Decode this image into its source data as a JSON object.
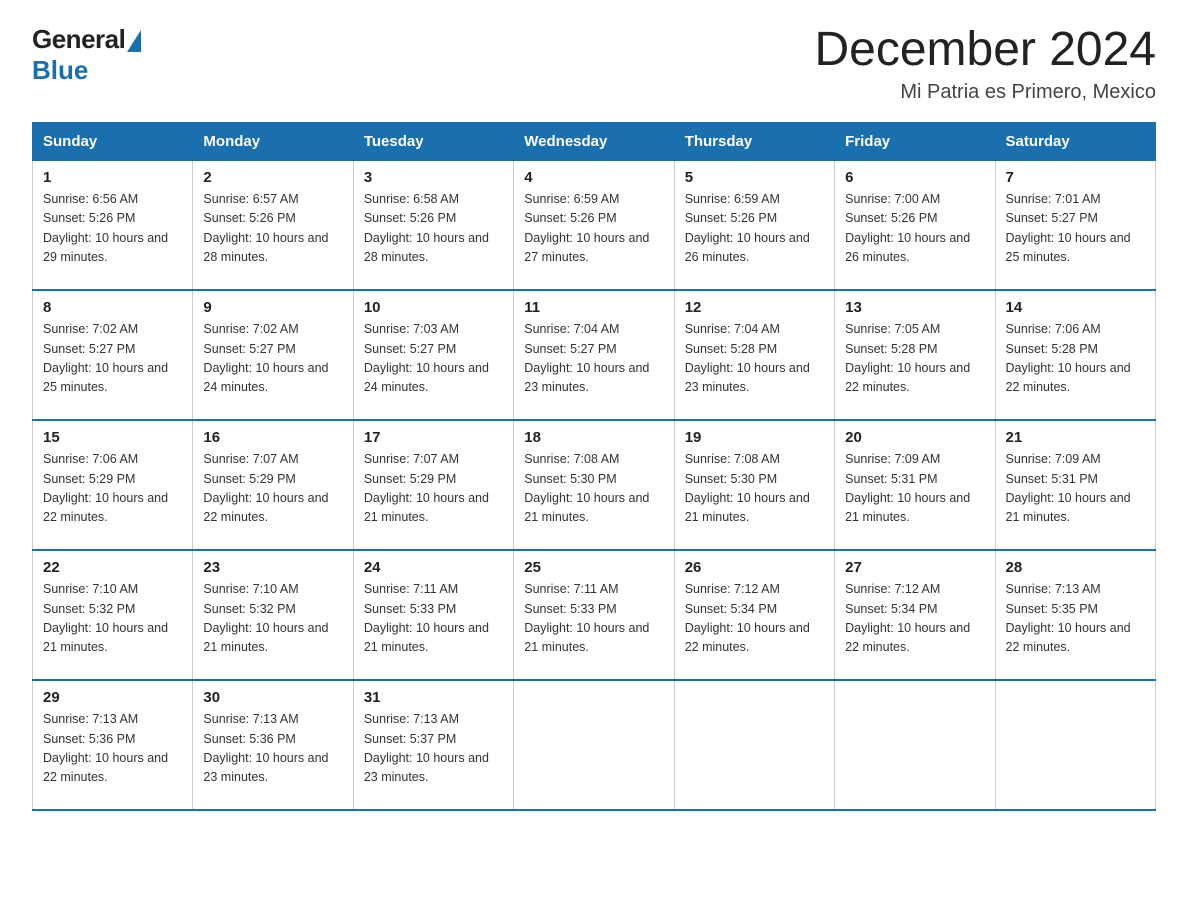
{
  "header": {
    "logo_general": "General",
    "logo_blue": "Blue",
    "title": "December 2024",
    "subtitle": "Mi Patria es Primero, Mexico"
  },
  "weekdays": [
    "Sunday",
    "Monday",
    "Tuesday",
    "Wednesday",
    "Thursday",
    "Friday",
    "Saturday"
  ],
  "weeks": [
    [
      {
        "day": "1",
        "sunrise": "6:56 AM",
        "sunset": "5:26 PM",
        "daylight": "10 hours and 29 minutes."
      },
      {
        "day": "2",
        "sunrise": "6:57 AM",
        "sunset": "5:26 PM",
        "daylight": "10 hours and 28 minutes."
      },
      {
        "day": "3",
        "sunrise": "6:58 AM",
        "sunset": "5:26 PM",
        "daylight": "10 hours and 28 minutes."
      },
      {
        "day": "4",
        "sunrise": "6:59 AM",
        "sunset": "5:26 PM",
        "daylight": "10 hours and 27 minutes."
      },
      {
        "day": "5",
        "sunrise": "6:59 AM",
        "sunset": "5:26 PM",
        "daylight": "10 hours and 26 minutes."
      },
      {
        "day": "6",
        "sunrise": "7:00 AM",
        "sunset": "5:26 PM",
        "daylight": "10 hours and 26 minutes."
      },
      {
        "day": "7",
        "sunrise": "7:01 AM",
        "sunset": "5:27 PM",
        "daylight": "10 hours and 25 minutes."
      }
    ],
    [
      {
        "day": "8",
        "sunrise": "7:02 AM",
        "sunset": "5:27 PM",
        "daylight": "10 hours and 25 minutes."
      },
      {
        "day": "9",
        "sunrise": "7:02 AM",
        "sunset": "5:27 PM",
        "daylight": "10 hours and 24 minutes."
      },
      {
        "day": "10",
        "sunrise": "7:03 AM",
        "sunset": "5:27 PM",
        "daylight": "10 hours and 24 minutes."
      },
      {
        "day": "11",
        "sunrise": "7:04 AM",
        "sunset": "5:27 PM",
        "daylight": "10 hours and 23 minutes."
      },
      {
        "day": "12",
        "sunrise": "7:04 AM",
        "sunset": "5:28 PM",
        "daylight": "10 hours and 23 minutes."
      },
      {
        "day": "13",
        "sunrise": "7:05 AM",
        "sunset": "5:28 PM",
        "daylight": "10 hours and 22 minutes."
      },
      {
        "day": "14",
        "sunrise": "7:06 AM",
        "sunset": "5:28 PM",
        "daylight": "10 hours and 22 minutes."
      }
    ],
    [
      {
        "day": "15",
        "sunrise": "7:06 AM",
        "sunset": "5:29 PM",
        "daylight": "10 hours and 22 minutes."
      },
      {
        "day": "16",
        "sunrise": "7:07 AM",
        "sunset": "5:29 PM",
        "daylight": "10 hours and 22 minutes."
      },
      {
        "day": "17",
        "sunrise": "7:07 AM",
        "sunset": "5:29 PM",
        "daylight": "10 hours and 21 minutes."
      },
      {
        "day": "18",
        "sunrise": "7:08 AM",
        "sunset": "5:30 PM",
        "daylight": "10 hours and 21 minutes."
      },
      {
        "day": "19",
        "sunrise": "7:08 AM",
        "sunset": "5:30 PM",
        "daylight": "10 hours and 21 minutes."
      },
      {
        "day": "20",
        "sunrise": "7:09 AM",
        "sunset": "5:31 PM",
        "daylight": "10 hours and 21 minutes."
      },
      {
        "day": "21",
        "sunrise": "7:09 AM",
        "sunset": "5:31 PM",
        "daylight": "10 hours and 21 minutes."
      }
    ],
    [
      {
        "day": "22",
        "sunrise": "7:10 AM",
        "sunset": "5:32 PM",
        "daylight": "10 hours and 21 minutes."
      },
      {
        "day": "23",
        "sunrise": "7:10 AM",
        "sunset": "5:32 PM",
        "daylight": "10 hours and 21 minutes."
      },
      {
        "day": "24",
        "sunrise": "7:11 AM",
        "sunset": "5:33 PM",
        "daylight": "10 hours and 21 minutes."
      },
      {
        "day": "25",
        "sunrise": "7:11 AM",
        "sunset": "5:33 PM",
        "daylight": "10 hours and 21 minutes."
      },
      {
        "day": "26",
        "sunrise": "7:12 AM",
        "sunset": "5:34 PM",
        "daylight": "10 hours and 22 minutes."
      },
      {
        "day": "27",
        "sunrise": "7:12 AM",
        "sunset": "5:34 PM",
        "daylight": "10 hours and 22 minutes."
      },
      {
        "day": "28",
        "sunrise": "7:13 AM",
        "sunset": "5:35 PM",
        "daylight": "10 hours and 22 minutes."
      }
    ],
    [
      {
        "day": "29",
        "sunrise": "7:13 AM",
        "sunset": "5:36 PM",
        "daylight": "10 hours and 22 minutes."
      },
      {
        "day": "30",
        "sunrise": "7:13 AM",
        "sunset": "5:36 PM",
        "daylight": "10 hours and 23 minutes."
      },
      {
        "day": "31",
        "sunrise": "7:13 AM",
        "sunset": "5:37 PM",
        "daylight": "10 hours and 23 minutes."
      },
      null,
      null,
      null,
      null
    ]
  ]
}
